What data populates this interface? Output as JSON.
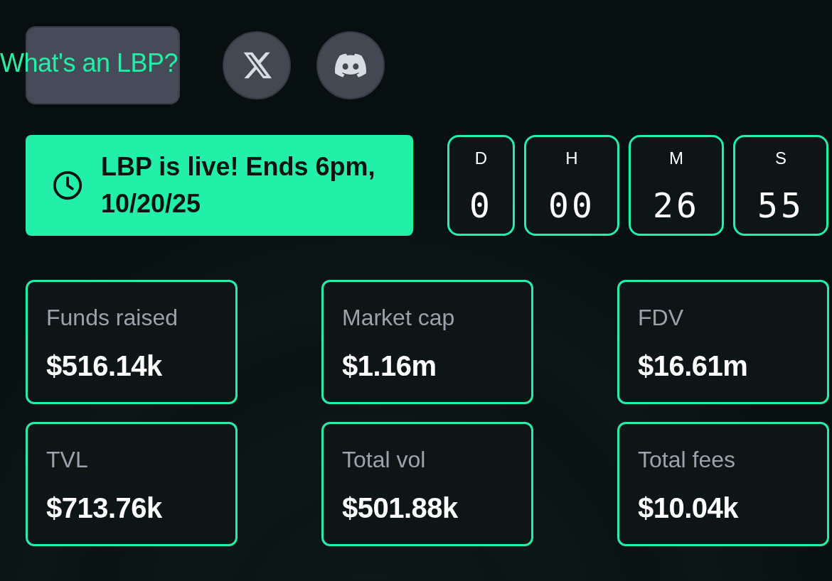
{
  "header": {
    "help_link": "What's an LBP?",
    "social": [
      {
        "kind": "x"
      },
      {
        "kind": "discord"
      }
    ]
  },
  "status_banner": {
    "text": "LBP is live! Ends 6pm, 10/20/25"
  },
  "countdown": [
    {
      "label": "D",
      "value": "0"
    },
    {
      "label": "H",
      "value": "00"
    },
    {
      "label": "M",
      "value": "26"
    },
    {
      "label": "S",
      "value": "55"
    }
  ],
  "stats": [
    {
      "label": "Funds raised",
      "value": "$516.14k"
    },
    {
      "label": "Market cap",
      "value": "$1.16m"
    },
    {
      "label": "FDV",
      "value": "$16.61m"
    },
    {
      "label": "TVL",
      "value": "$713.76k"
    },
    {
      "label": "Total vol",
      "value": "$501.88k"
    },
    {
      "label": "Total fees",
      "value": "$10.04k"
    }
  ]
}
